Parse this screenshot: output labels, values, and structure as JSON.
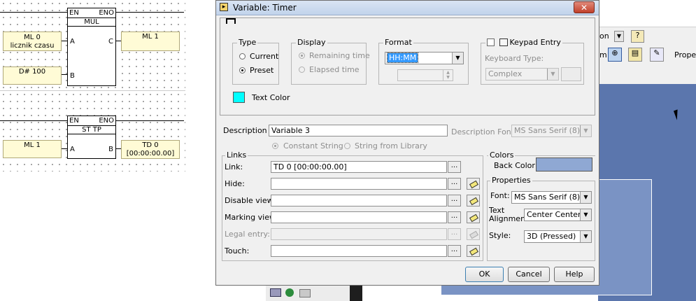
{
  "ladder": {
    "mul_block": {
      "en": "EN",
      "eno": "ENO",
      "name": "MUL",
      "pin_a": "A",
      "pin_b": "B",
      "pin_c": "C"
    },
    "mul_in_a": {
      "line1": "ML 0",
      "line2": "licznik czasu"
    },
    "mul_in_b": "D# 100",
    "mul_out_c": "ML 1",
    "sttp_block": {
      "en": "EN",
      "eno": "ENO",
      "name": "ST TP",
      "pin_a": "A",
      "pin_b": "B"
    },
    "sttp_in_a": "ML 1",
    "sttp_out_b": {
      "line1": "TD 0",
      "line2": "[00:00:00.00]"
    }
  },
  "background_app": {
    "toolbar_text1": "on",
    "toolbar_text2": "m",
    "toolbar_text3": "Proper"
  },
  "dialog": {
    "title": "Variable: Timer",
    "close": "✕",
    "type_group": {
      "label": "Type",
      "current": "Current",
      "preset": "Preset",
      "selected": "Preset"
    },
    "display_group": {
      "label": "Display",
      "remaining": "Remaining time",
      "elapsed": "Elapsed time"
    },
    "format_group": {
      "label": "Format",
      "value": "HH:MM"
    },
    "keypad_group": {
      "label": "Keypad Entry",
      "keyboard_type_label": "Keyboard Type:",
      "keyboard_type_value": "Complex"
    },
    "text_color_label": "Text Color",
    "text_color": "#00ffff",
    "description_label": "Description :",
    "description_value": "Variable 3",
    "description_font_label": "Description Font:",
    "description_font_value": "MS Sans Serif (8)",
    "constant_string": "Constant String",
    "string_from_library": "String from Library",
    "links_group": {
      "label": "Links",
      "link_label": "Link:",
      "link_value": "TD 0 [00:00:00.00]",
      "hide_label": "Hide:",
      "disable_view_label": "Disable view:",
      "marking_view_label": "Marking view:",
      "legal_entry_label": "Legal entry:",
      "touch_label": "Touch:",
      "ellipsis": "..."
    },
    "colors_group": {
      "label": "Colors",
      "back_color_label": "Back Color",
      "back_color": "#8fa8d3"
    },
    "properties_group": {
      "label": "Properties",
      "font_label": "Font:",
      "font_value": "MS Sans Serif (8)",
      "text_label": "Text",
      "alignment_label": "Alignment",
      "alignment_value": "Center Center",
      "style_label": "Style:",
      "style_value": "3D (Pressed)"
    },
    "ok": "OK",
    "cancel": "Cancel",
    "help": "Help"
  }
}
